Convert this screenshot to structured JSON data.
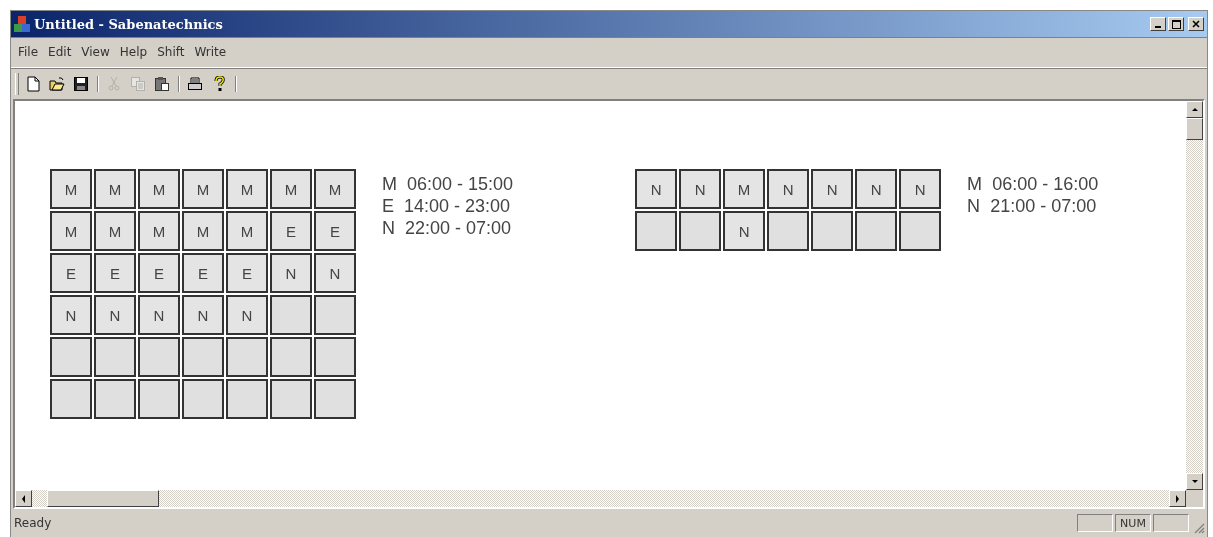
{
  "window": {
    "title": "Untitled - Sabenatechnics"
  },
  "menu": [
    "File",
    "Edit",
    "View",
    "Help",
    "Shift",
    "Write"
  ],
  "toolbar": [
    [
      {
        "kind": "new",
        "disabled": false
      },
      {
        "kind": "open",
        "disabled": false
      },
      {
        "kind": "save",
        "disabled": false
      }
    ],
    [
      {
        "kind": "cut",
        "disabled": true
      },
      {
        "kind": "copy",
        "disabled": true
      },
      {
        "kind": "paste",
        "disabled": false
      }
    ],
    [
      {
        "kind": "print",
        "disabled": false
      },
      {
        "kind": "help",
        "disabled": false
      }
    ]
  ],
  "schedules": [
    {
      "grid": [
        [
          {
            "filled": true,
            "shift": "M"
          },
          {
            "filled": true,
            "shift": "M"
          },
          {
            "filled": true,
            "shift": "M"
          },
          {
            "filled": true,
            "shift": "M"
          },
          {
            "filled": true,
            "shift": "M"
          },
          {
            "filled": true,
            "shift": "M"
          },
          {
            "filled": true,
            "shift": "M"
          }
        ],
        [
          {
            "filled": true,
            "shift": "M"
          },
          {
            "filled": true,
            "shift": "M"
          },
          {
            "filled": true,
            "shift": "M"
          },
          {
            "filled": true,
            "shift": "M"
          },
          {
            "filled": true,
            "shift": "M"
          },
          {
            "filled": true,
            "shift": "E"
          },
          {
            "filled": true,
            "shift": "E"
          }
        ],
        [
          {
            "filled": true,
            "shift": "E"
          },
          {
            "filled": true,
            "shift": "E"
          },
          {
            "filled": true,
            "shift": "E"
          },
          {
            "filled": true,
            "shift": "E"
          },
          {
            "filled": true,
            "shift": "E"
          },
          {
            "filled": true,
            "shift": "N"
          },
          {
            "filled": true,
            "shift": "N"
          }
        ],
        [
          {
            "filled": true,
            "shift": "N"
          },
          {
            "filled": true,
            "shift": "N"
          },
          {
            "filled": true,
            "shift": "N"
          },
          {
            "filled": true,
            "shift": "N"
          },
          {
            "filled": true,
            "shift": "N"
          },
          {
            "filled": false
          },
          {
            "filled": false
          }
        ],
        [
          {
            "filled": false
          },
          {
            "filled": false
          },
          {
            "filled": false
          },
          {
            "filled": false
          },
          {
            "filled": false
          },
          {
            "filled": false
          },
          {
            "filled": false
          }
        ],
        [
          {
            "filled": false
          },
          {
            "filled": false
          },
          {
            "filled": false
          },
          {
            "filled": false
          },
          {
            "filled": false
          },
          {
            "filled": false
          },
          {
            "filled": false
          }
        ]
      ],
      "legend": [
        {
          "code": "M",
          "hours": "06:00 - 15:00"
        },
        {
          "code": "E",
          "hours": "14:00 - 23:00"
        },
        {
          "code": "N",
          "hours": "22:00 - 07:00"
        }
      ]
    },
    {
      "grid": [
        [
          {
            "filled": true,
            "shift": "N"
          },
          {
            "filled": true,
            "shift": "N"
          },
          {
            "filled": true,
            "shift": "M"
          },
          {
            "filled": true,
            "shift": "N"
          },
          {
            "filled": true,
            "shift": "N"
          },
          {
            "filled": true,
            "shift": "N"
          },
          {
            "filled": true,
            "shift": "N"
          }
        ],
        [
          {
            "filled": false
          },
          {
            "filled": false
          },
          {
            "filled": true,
            "shift": "N"
          },
          {
            "filled": false
          },
          {
            "filled": false
          },
          {
            "filled": false
          },
          {
            "filled": false
          }
        ]
      ],
      "legend": [
        {
          "code": "M",
          "hours": "06:00 - 16:00"
        },
        {
          "code": "N",
          "hours": "21:00 - 07:00"
        }
      ]
    }
  ],
  "status_bar": {
    "message": "Ready",
    "num_indicator": "NUM"
  }
}
